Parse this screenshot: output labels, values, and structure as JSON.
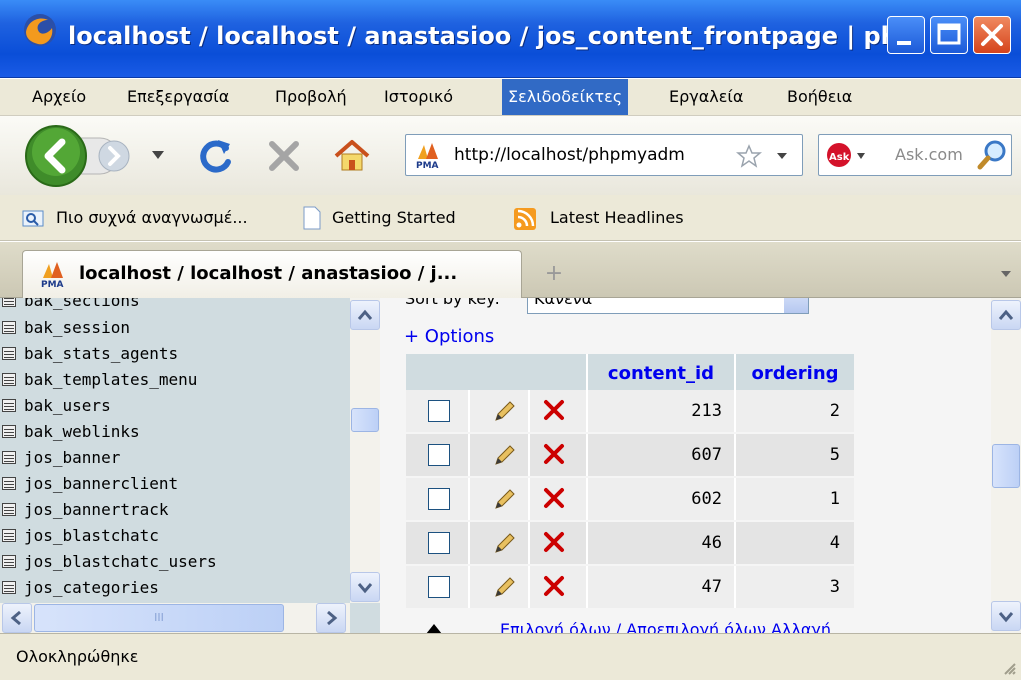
{
  "window": {
    "title": "localhost / localhost / anastasioo / jos_content_frontpage | php..."
  },
  "menubar": {
    "items": [
      "Αρχείο",
      "Επεξεργασία",
      "Προβολή",
      "Ιστορικό",
      "Σελιδοδείκτες",
      "Εργαλεία",
      "Βοήθεια"
    ],
    "active": "Σελιδοδείκτες"
  },
  "navbar": {
    "url": "http://localhost/phpmyadm",
    "search_placeholder": "Ask.com"
  },
  "bookmarks": {
    "items": [
      "Πιο συχνά αναγνωσμέ...",
      "Getting Started",
      "Latest Headlines"
    ]
  },
  "tab": {
    "label": "localhost / localhost / anastasioo / j...",
    "new_tab_symbol": "+"
  },
  "left_nav": {
    "tables": [
      "bak_sections",
      "bak_session",
      "bak_stats_agents",
      "bak_templates_menu",
      "bak_users",
      "bak_weblinks",
      "jos_banner",
      "jos_bannerclient",
      "jos_bannertrack",
      "jos_blastchatc",
      "jos_blastchatc_users",
      "jos_categories"
    ],
    "scroll_thumb_label": "III"
  },
  "main": {
    "sort_label": "Sort by key:",
    "sort_value": "Κανένα",
    "options_link": "+ Options",
    "columns": [
      "content_id",
      "ordering"
    ],
    "rows": [
      {
        "content_id": "213",
        "ordering": "2"
      },
      {
        "content_id": "607",
        "ordering": "5"
      },
      {
        "content_id": "602",
        "ordering": "1"
      },
      {
        "content_id": "46",
        "ordering": "4"
      },
      {
        "content_id": "47",
        "ordering": "3"
      }
    ],
    "footer_text": "Επιλογή όλων / Αποεπιλογή όλων Αλλαγή"
  },
  "status": {
    "text": "Ολοκληρώθηκε"
  },
  "colors": {
    "titlebar": "#1f62e0",
    "menu_active": "#316ac5",
    "nav_frame": "#d0dce0",
    "link": "#0000ee",
    "delete_red": "#cc0000"
  }
}
